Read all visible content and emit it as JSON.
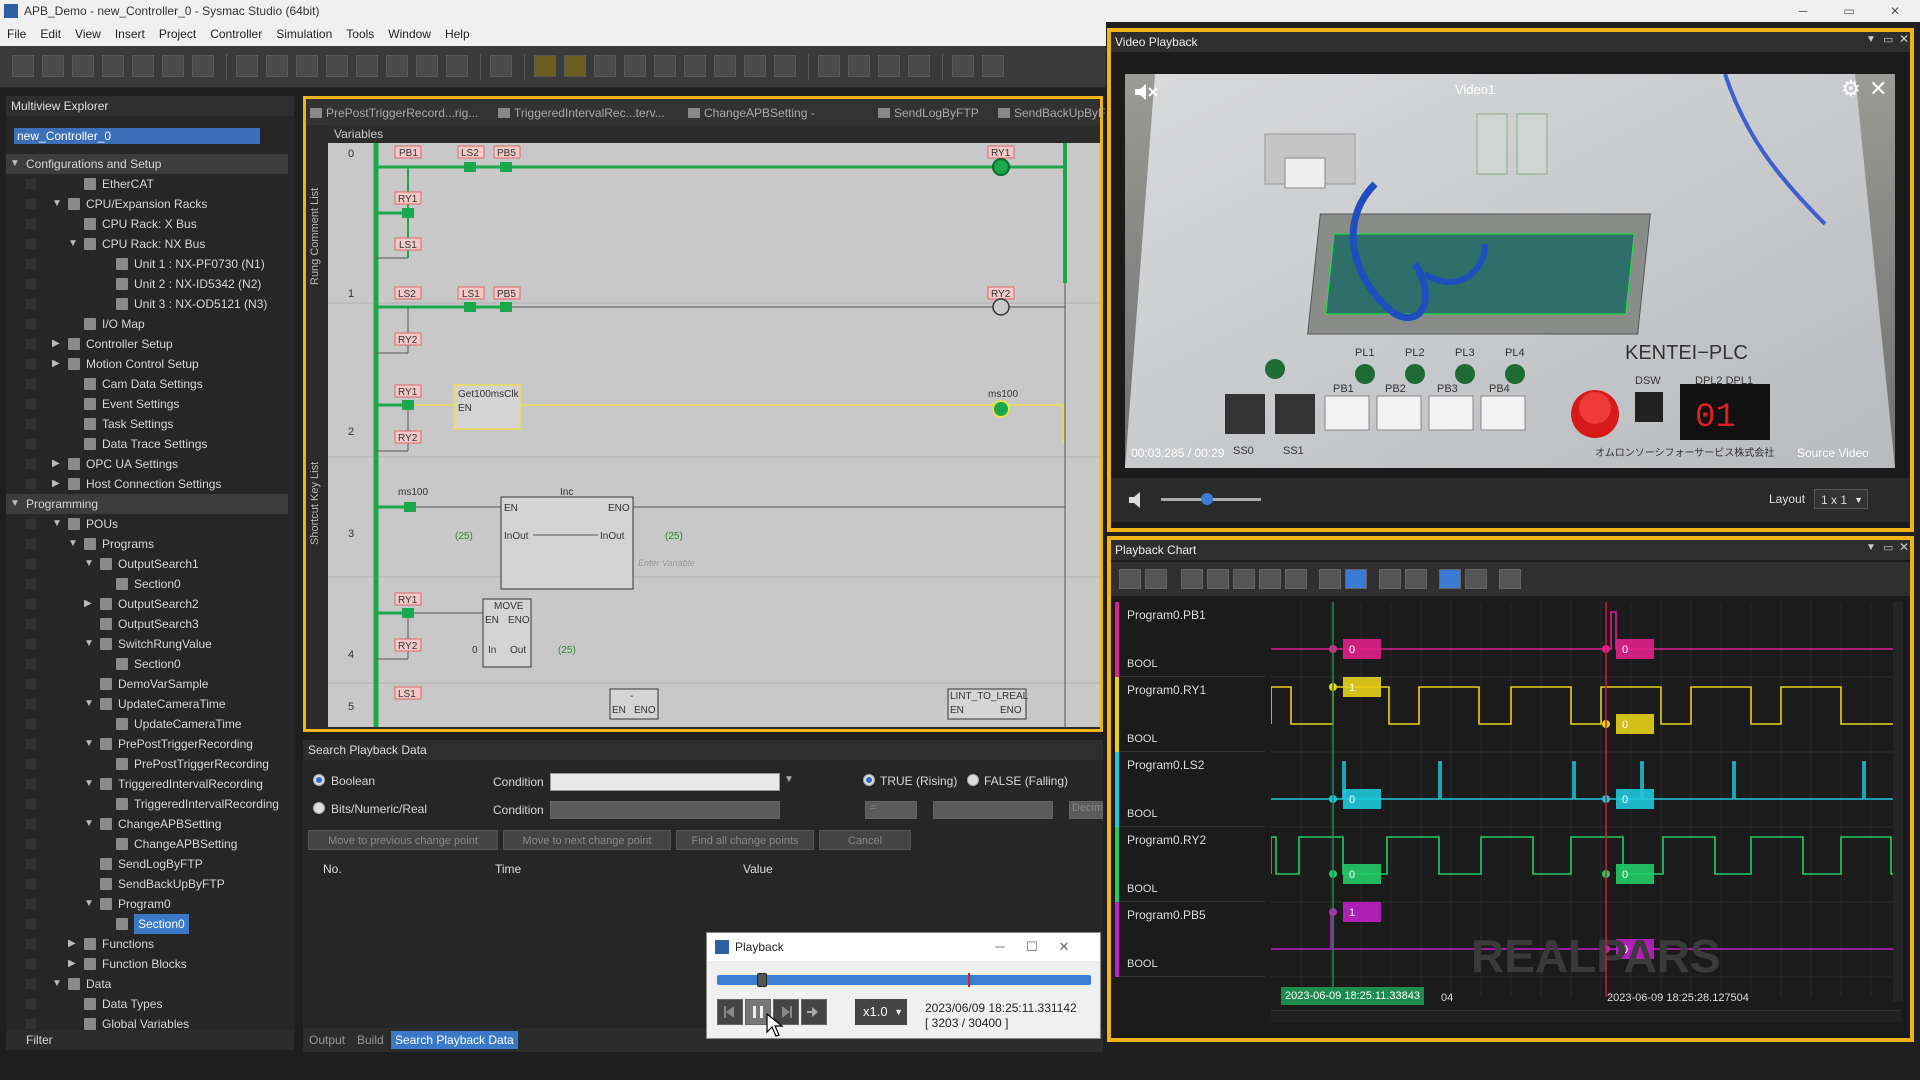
{
  "title_bar": {
    "title": "APB_Demo - new_Controller_0 - Sysmac Studio (64bit)"
  },
  "menu": [
    "File",
    "Edit",
    "View",
    "Insert",
    "Project",
    "Controller",
    "Simulation",
    "Tools",
    "Window",
    "Help"
  ],
  "explorer": {
    "title": "Multiview Explorer",
    "controller": "new_Controller_0",
    "filter": "Filter",
    "items": [
      {
        "label": "Configurations and Setup",
        "level": 0,
        "arrow": "▼",
        "group": true
      },
      {
        "label": "EtherCAT",
        "level": 2
      },
      {
        "label": "CPU/Expansion Racks",
        "level": 1,
        "arrow": "▼"
      },
      {
        "label": "CPU Rack: X Bus",
        "level": 2
      },
      {
        "label": "CPU Rack: NX Bus",
        "level": 2,
        "arrow": "▼"
      },
      {
        "label": "Unit 1 : NX-PF0730 (N1)",
        "level": 4
      },
      {
        "label": "Unit 2 : NX-ID5342 (N2)",
        "level": 4
      },
      {
        "label": "Unit 3 : NX-OD5121 (N3)",
        "level": 4
      },
      {
        "label": "I/O Map",
        "level": 2
      },
      {
        "label": "Controller Setup",
        "level": 1,
        "arrow": "▶"
      },
      {
        "label": "Motion Control Setup",
        "level": 1,
        "arrow": "▶"
      },
      {
        "label": "Cam Data Settings",
        "level": 2
      },
      {
        "label": "Event Settings",
        "level": 2
      },
      {
        "label": "Task Settings",
        "level": 2
      },
      {
        "label": "Data Trace Settings",
        "level": 2
      },
      {
        "label": "OPC UA Settings",
        "level": 1,
        "arrow": "▶"
      },
      {
        "label": "Host Connection Settings",
        "level": 1,
        "arrow": "▶"
      },
      {
        "label": "Programming",
        "level": 0,
        "arrow": "▼",
        "group": true
      },
      {
        "label": "POUs",
        "level": 1,
        "arrow": "▼"
      },
      {
        "label": "Programs",
        "level": 2,
        "arrow": "▼"
      },
      {
        "label": "OutputSearch1",
        "level": 3,
        "arrow": "▼"
      },
      {
        "label": "Section0",
        "level": 4
      },
      {
        "label": "OutputSearch2",
        "level": 3,
        "arrow": "▶"
      },
      {
        "label": "OutputSearch3",
        "level": 3
      },
      {
        "label": "SwitchRungValue",
        "level": 3,
        "arrow": "▼"
      },
      {
        "label": "Section0",
        "level": 4
      },
      {
        "label": "DemoVarSample",
        "level": 3
      },
      {
        "label": "UpdateCameraTime",
        "level": 3,
        "arrow": "▼"
      },
      {
        "label": "UpdateCameraTime",
        "level": 4
      },
      {
        "label": "PrePostTriggerRecording",
        "level": 3,
        "arrow": "▼"
      },
      {
        "label": "PrePostTriggerRecording",
        "level": 4
      },
      {
        "label": "TriggeredIntervalRecording",
        "level": 3,
        "arrow": "▼"
      },
      {
        "label": "TriggeredIntervalRecording",
        "level": 4
      },
      {
        "label": "ChangeAPBSetting",
        "level": 3,
        "arrow": "▼"
      },
      {
        "label": "ChangeAPBSetting",
        "level": 4
      },
      {
        "label": "SendLogByFTP",
        "level": 3
      },
      {
        "label": "SendBackUpByFTP",
        "level": 3
      },
      {
        "label": "Program0",
        "level": 3,
        "arrow": "▼"
      },
      {
        "label": "Section0",
        "level": 4,
        "selected": true
      },
      {
        "label": "Functions",
        "level": 2,
        "arrow": "▶"
      },
      {
        "label": "Function Blocks",
        "level": 2,
        "arrow": "▶"
      },
      {
        "label": "Data",
        "level": 1,
        "arrow": "▼"
      },
      {
        "label": "Data Types",
        "level": 2
      },
      {
        "label": "Global Variables",
        "level": 2
      }
    ]
  },
  "ladder": {
    "tabs": [
      "PrePostTriggerRecord...rig...",
      "TriggeredIntervalRec...terv...",
      "ChangeAPBSetting - Chan...",
      "SendLogByFTP",
      "SendBackUpByF"
    ],
    "variables_label": "Variables",
    "side_label_top": "Rung Comment List",
    "side_label_bottom": "Shortcut Key List",
    "rung_numbers": [
      "0",
      "1",
      "2",
      "3",
      "4",
      "5"
    ],
    "contacts": {
      "pb1": "PB1",
      "ls2": "LS2",
      "pb5": "PB5",
      "ry1": "RY1",
      "ls1": "LS1",
      "ry2": "RY2"
    },
    "coils": {
      "ry1": "RY1",
      "ry2": "RY2",
      "ms100": "ms100"
    },
    "rung3_contact": "ms100",
    "fb_get100": {
      "name": "Get100msClk",
      "pin": "EN"
    },
    "fb_inc": {
      "name": "Inc",
      "en": "EN",
      "eno": "ENO",
      "inout_left": "InOut",
      "inout_right": "InOut",
      "value_left": "(25)",
      "value_right": "(25)",
      "placeholder": "Enter Variable"
    },
    "fb_move": {
      "name": "MOVE",
      "en": "EN",
      "eno": "ENO",
      "in": "In",
      "out": "Out",
      "in_value": "0",
      "out_value": "(25)"
    },
    "fb_dash": {
      "name": "-",
      "en": "EN",
      "eno": "ENO"
    },
    "fb_lint": {
      "name": "LINT_TO_LREAL",
      "en": "EN",
      "eno": "ENO"
    }
  },
  "search_panel": {
    "title": "Search Playback Data",
    "boolean_label": "Boolean",
    "bits_label": "Bits/Numeric/Real",
    "condition_label": "Condition",
    "true_rising": "TRUE (Rising)",
    "false_falling": "FALSE (Falling)",
    "operator": "=",
    "format": "Decim",
    "buttons": [
      "Move to previous change point",
      "Move to next change point",
      "Find all change points",
      "Cancel"
    ],
    "columns": [
      "No.",
      "Time",
      "Value"
    ],
    "bottom_tabs": [
      "Output",
      "Build",
      "Search Playback Data"
    ]
  },
  "playback_dialog": {
    "title": "Playback",
    "speed": "x1.0",
    "timestamp": "2023/06/09 18:25:11.331142",
    "frame": "[ 3203 / 30400 ]",
    "progress_fraction": 0.11,
    "marker_fraction": 0.67
  },
  "video": {
    "title": "Video Playback",
    "stream_label": "Video1",
    "time": "00:03.285 / 00:29",
    "source": "Source Video",
    "layout_label": "Layout",
    "layout_value": "1 x 1",
    "volume_fraction": 0.45,
    "scene": {
      "brand": "KENTEI−PLC",
      "company": "オムロンソーシフォーサービス株式会社",
      "lamps": [
        "PL1",
        "PL2",
        "PL3",
        "PL4"
      ],
      "buttons": [
        "PB1",
        "PB2",
        "PB3",
        "PB4"
      ],
      "switches": [
        "SS0",
        "SS1"
      ],
      "dip": "DSW",
      "dpl": "DPL2 DPL1",
      "display": "01"
    }
  },
  "chart": {
    "title": "Playback Chart",
    "signals": [
      {
        "name": "Program0.PB1",
        "type": "BOOL",
        "color": "#e0208c",
        "value_at_cursor": "0",
        "value_at_marker": "0"
      },
      {
        "name": "Program0.RY1",
        "type": "BOOL",
        "color": "#e8d21a",
        "value_at_cursor": "1",
        "value_at_marker": "0"
      },
      {
        "name": "Program0.LS2",
        "type": "BOOL",
        "color": "#1ec8dc",
        "value_at_cursor": "0",
        "value_at_marker": "0"
      },
      {
        "name": "Program0.RY2",
        "type": "BOOL",
        "color": "#22cc66",
        "value_at_cursor": "0",
        "value_at_marker": "0"
      },
      {
        "name": "Program0.PB5",
        "type": "BOOL",
        "color": "#c020c8",
        "value_at_cursor": "1",
        "value_at_marker": "0"
      }
    ],
    "ylabels": [
      "1",
      "0"
    ],
    "cursor_time": "2023-06-09 18:25:11.33843",
    "cursor_time_suffix": "04",
    "marker_time": "2023-06-09 18:25:28.127504",
    "watermark": "REALPARS"
  }
}
